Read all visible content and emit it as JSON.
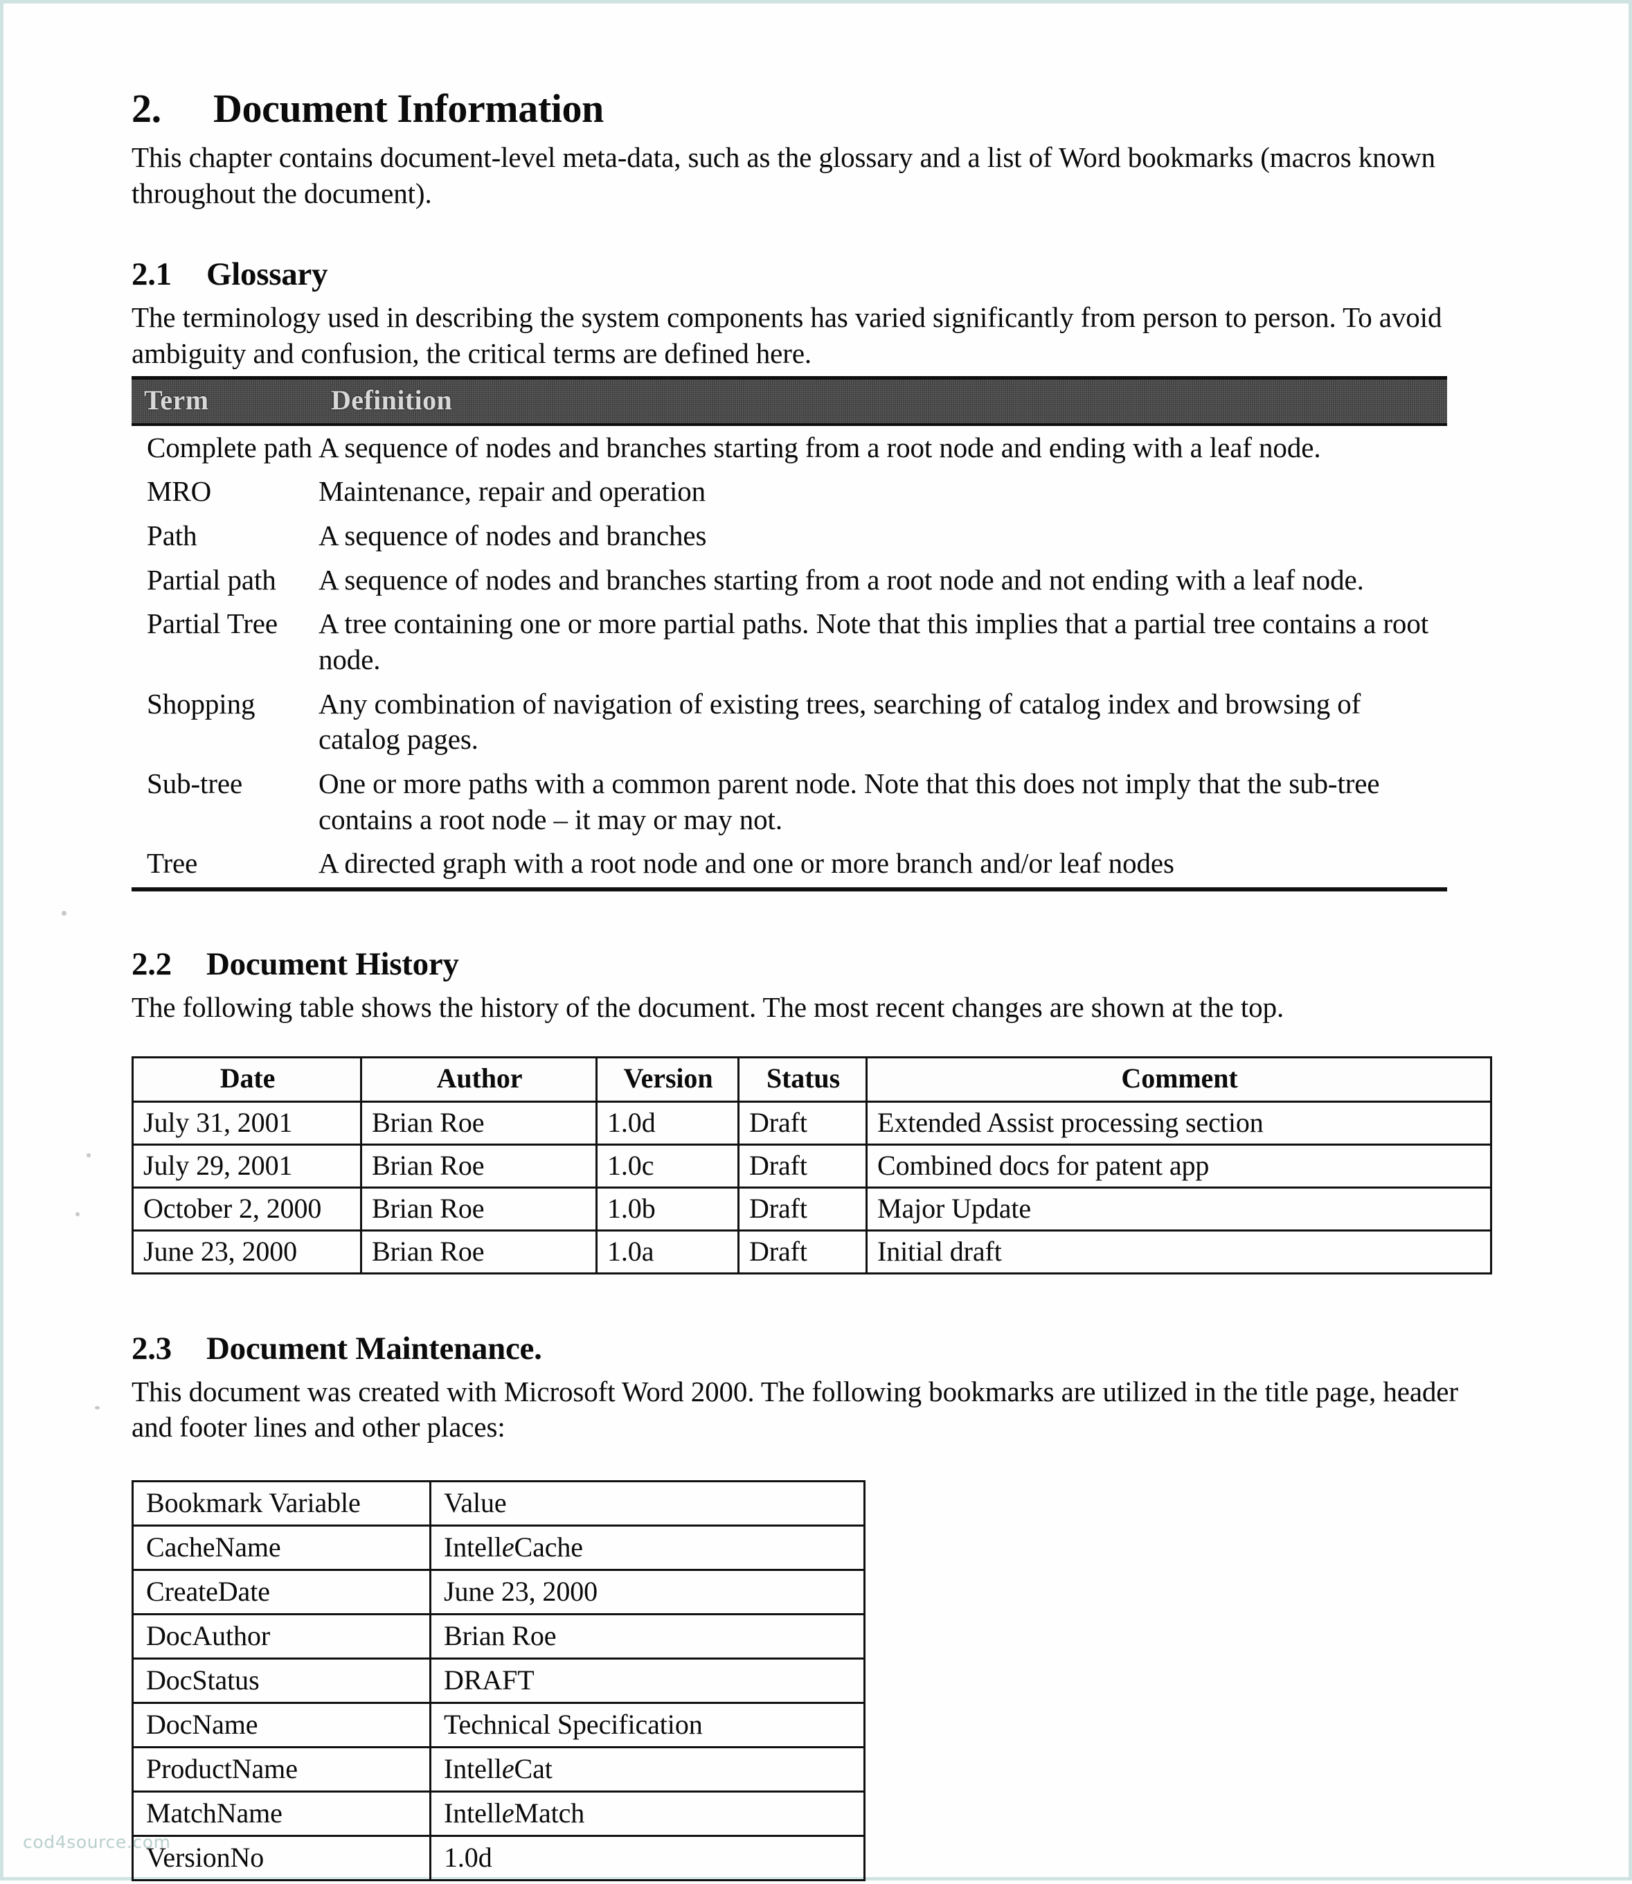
{
  "page": {
    "watermark": "cod4source.com"
  },
  "chapter": {
    "number": "2.",
    "title": "Document Information",
    "intro": "This chapter contains document-level meta-data, such as the glossary and a list of Word bookmarks (macros known throughout the document)."
  },
  "glossary": {
    "number": "2.1",
    "title": "Glossary",
    "intro": "The terminology used in describing the system components has varied significantly from person to person.  To avoid ambiguity and confusion, the critical terms are defined here.",
    "columns": [
      "Term",
      "Definition"
    ],
    "rows": [
      {
        "term": "Complete path",
        "definition": "A sequence of nodes and branches starting from a root node and ending with a leaf node."
      },
      {
        "term": "MRO",
        "definition": "Maintenance, repair and operation"
      },
      {
        "term": "Path",
        "definition": "A sequence of nodes and branches"
      },
      {
        "term": "Partial path",
        "definition": "A sequence of nodes and branches starting from a root node and not ending with a leaf node."
      },
      {
        "term": "Partial Tree",
        "definition": "A tree containing one or more partial paths.  Note that this implies that a partial tree contains a root node."
      },
      {
        "term": "Shopping",
        "definition": "Any combination of navigation of existing trees, searching of catalog index and browsing of catalog pages."
      },
      {
        "term": "Sub-tree",
        "definition": "One or more paths with a common parent node.  Note that this does not imply that the sub-tree contains a root node – it may or may not."
      },
      {
        "term": "Tree",
        "definition": "A directed graph with a root node and one or more branch and/or leaf nodes"
      }
    ]
  },
  "history": {
    "number": "2.2",
    "title": "Document History",
    "intro": "The following table shows the history of the document.  The most recent changes are shown at the top.",
    "columns": [
      "Date",
      "Author",
      "Version",
      "Status",
      "Comment"
    ],
    "rows": [
      {
        "date": "July 31, 2001",
        "author": "Brian Roe",
        "version": "1.0d",
        "status": "Draft",
        "comment": "Extended Assist processing section"
      },
      {
        "date": "July 29, 2001",
        "author": "Brian Roe",
        "version": "1.0c",
        "status": "Draft",
        "comment": "Combined docs for patent app"
      },
      {
        "date": "October 2, 2000",
        "author": "Brian Roe",
        "version": "1.0b",
        "status": "Draft",
        "comment": "Major Update"
      },
      {
        "date": "June 23, 2000",
        "author": "Brian Roe",
        "version": "1.0a",
        "status": "Draft",
        "comment": "Initial draft"
      }
    ]
  },
  "maintenance": {
    "number": "2.3",
    "title": "Document Maintenance.",
    "intro": "This document was created with Microsoft Word 2000. The following bookmarks are utilized in the title page, header and footer lines and other places:",
    "columns": [
      "Bookmark Variable",
      "Value"
    ],
    "rows": [
      {
        "variable": "CacheName",
        "value_pre": "Intell",
        "value_em": "e",
        "value_post": "Cache"
      },
      {
        "variable": "CreateDate",
        "value_pre": "June 23, 2000",
        "value_em": "",
        "value_post": ""
      },
      {
        "variable": "DocAuthor",
        "value_pre": "Brian Roe",
        "value_em": "",
        "value_post": ""
      },
      {
        "variable": "DocStatus",
        "value_pre": "DRAFT",
        "value_em": "",
        "value_post": ""
      },
      {
        "variable": "DocName",
        "value_pre": "Technical Specification",
        "value_em": "",
        "value_post": ""
      },
      {
        "variable": "ProductName",
        "value_pre": "Intell",
        "value_em": "e",
        "value_post": "Cat"
      },
      {
        "variable": "MatchName",
        "value_pre": "Intell",
        "value_em": "e",
        "value_post": "Match"
      },
      {
        "variable": "VersionNo",
        "value_pre": "1.0d",
        "value_em": "",
        "value_post": ""
      }
    ]
  }
}
